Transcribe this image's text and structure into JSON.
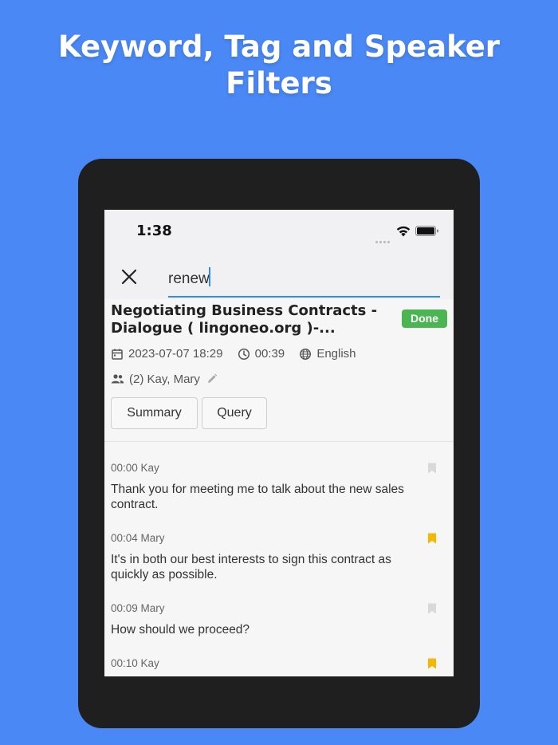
{
  "headline": {
    "line1": "Keyword, Tag and Speaker",
    "line2": "Filters"
  },
  "status_bar": {
    "time": "1:38"
  },
  "search": {
    "value": "renew",
    "icon": "close-icon"
  },
  "recording": {
    "title_line1": "Negotiating Business Contracts -",
    "title_line2": "Dialogue ( lingoneo.org )-...",
    "status": "Done",
    "status_color": "#4bb553",
    "date": "2023-07-07 18:29",
    "duration": "00:39",
    "language": "English",
    "speakers": "(2) Kay, Mary",
    "buttons": {
      "summary": "Summary",
      "query": "Query"
    }
  },
  "segments": [
    {
      "time_speaker": "00:00 Kay",
      "text_line1": "Thank you for meeting me to talk about the new sales",
      "text_line2": "contract.",
      "bookmarked": false
    },
    {
      "time_speaker": "00:04 Mary",
      "text_line1": "It's in both our best interests to sign this contract as",
      "text_line2": "quickly as possible.",
      "bookmarked": true
    },
    {
      "time_speaker": "00:09 Mary",
      "text_line1": "How should we proceed?",
      "text_line2": "",
      "bookmarked": false
    },
    {
      "time_speaker": "00:10 Kay",
      "text_line1": "",
      "text_line2": "",
      "bookmarked": true
    }
  ],
  "colors": {
    "background": "#4a88f5",
    "accent": "#2f8ee8",
    "bookmark_active": "#f5b800",
    "bookmark_inactive": "#d9d9d9"
  }
}
